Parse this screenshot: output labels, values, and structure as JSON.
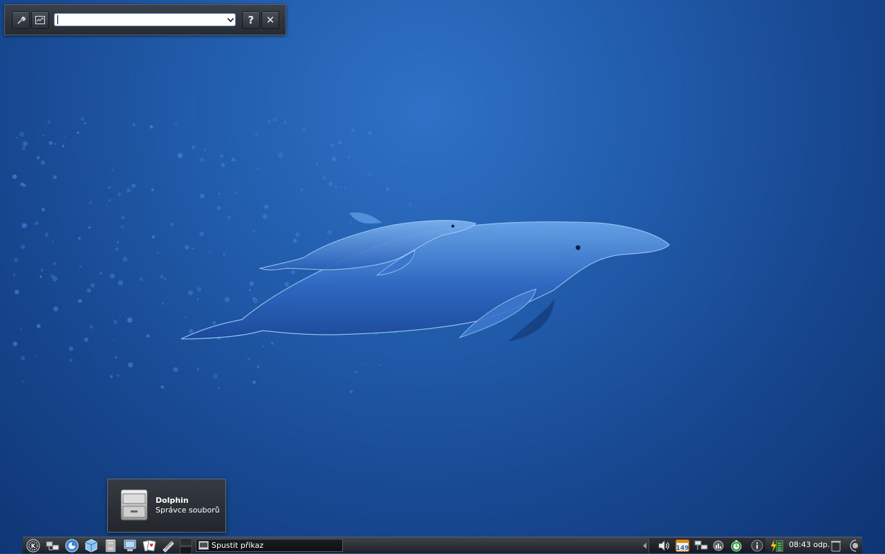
{
  "krunner": {
    "settings_button": "settings",
    "activity_button": "show system activity",
    "query_value": "",
    "help_label": "?",
    "close_label": "✕"
  },
  "tooltip": {
    "title": "Dolphin",
    "subtitle": "Správce souborů"
  },
  "panel": {
    "launchers": [
      {
        "icon": "kde-menu-icon"
      },
      {
        "icon": "network-computer-icon"
      },
      {
        "icon": "konqueror-icon"
      },
      {
        "icon": "package-cube-icon"
      },
      {
        "icon": "file-cabinet-icon"
      },
      {
        "icon": "system-settings-icon"
      },
      {
        "icon": "card-game-icon"
      },
      {
        "icon": "document-edit-icon"
      }
    ],
    "pager_desktops": 2,
    "active_desktop": 1,
    "task": {
      "label": "Spustit příkaz",
      "icon": "terminal-window-icon"
    },
    "tray_icons": [
      "arrow-left-icon",
      "volume-icon",
      "calendar-icon",
      "network-icon",
      "network-monitor-icon",
      "timer-icon",
      "info-icon"
    ],
    "calendar_day": "149",
    "battery_icon": "battery-charging-icon",
    "clock": "08:43 odp.",
    "trash_icon": "trash-icon",
    "cashew_icon": "plasma-cashew-icon"
  },
  "colors": {
    "desktop_blue": "#215cab",
    "panel_dark": "#1d2024",
    "accent": "#6b8fc4"
  }
}
